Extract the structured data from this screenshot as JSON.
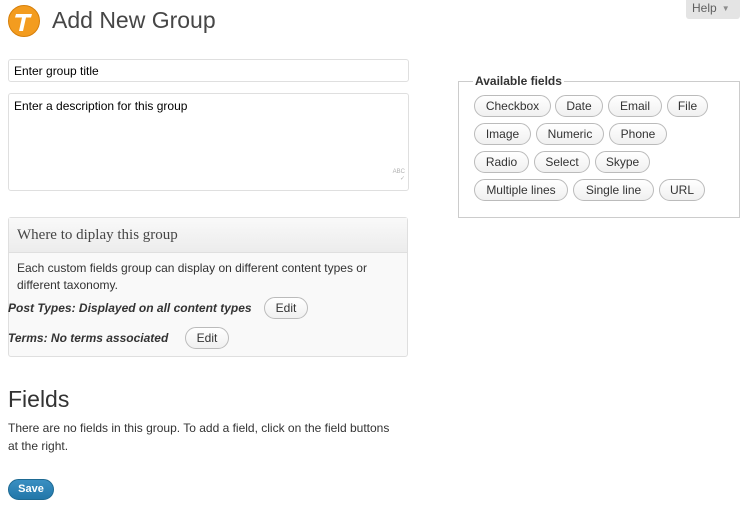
{
  "header": {
    "title": "Add New Group",
    "help_label": "Help",
    "logo_icon": "types-logo-icon",
    "logo_color": "#f39c1f"
  },
  "group": {
    "title_placeholder": "Enter group title",
    "description_placeholder": "Enter a description for this group"
  },
  "display": {
    "heading": "Where to diplay this group",
    "description": "Each custom fields group can display on different content types or different taxonomy.",
    "post_types_label": "Post Types: Displayed on all content types",
    "post_types_edit": "Edit",
    "terms_label": "Terms: No terms associated",
    "terms_edit": "Edit"
  },
  "fields": {
    "heading": "Fields",
    "empty_message": "There are no fields in this group. To add a field, click on the field buttons at the right.",
    "save_label": "Save",
    "save_color": "#2a80b5"
  },
  "available": {
    "legend": "Available fields",
    "buttons": [
      "Checkbox",
      "Date",
      "Email",
      "File",
      "Image",
      "Numeric",
      "Phone",
      "Radio",
      "Select",
      "Skype",
      "Multiple lines",
      "Single line",
      "URL"
    ]
  }
}
